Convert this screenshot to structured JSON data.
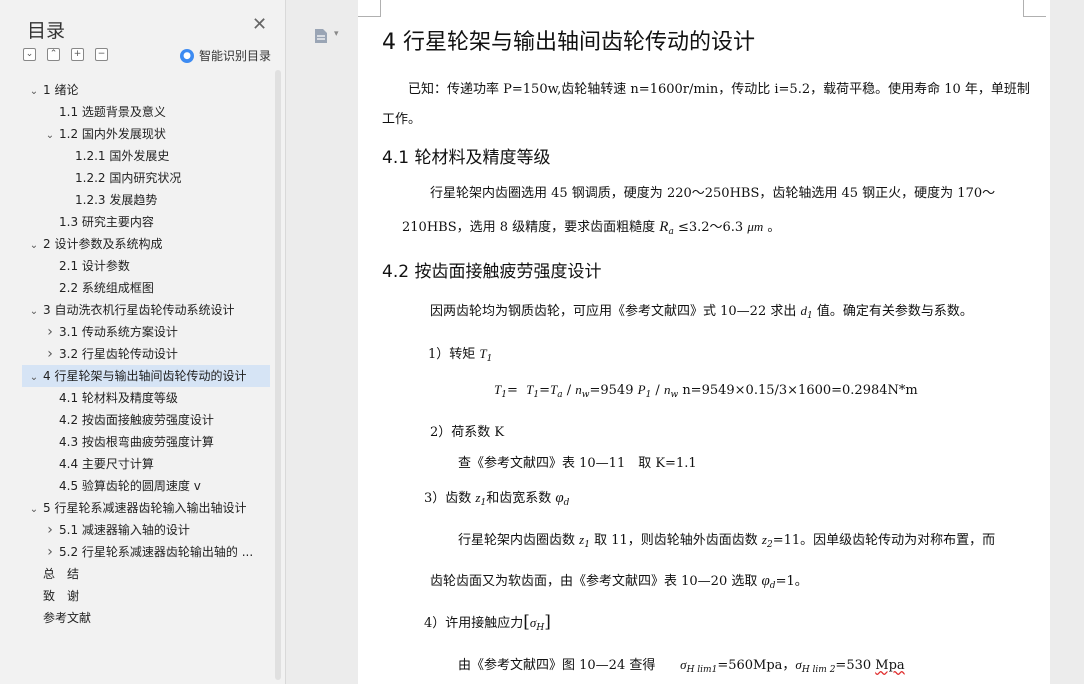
{
  "toc": {
    "title": "目录",
    "ai_label": "智能识别目录",
    "items": [
      {
        "label": "1 绪论",
        "chev": "v"
      },
      {
        "label": "1.1 选题背景及意义",
        "chev": ""
      },
      {
        "label": "1.2 国内外发展现状",
        "chev": "v"
      },
      {
        "label": "1.2.1 国外发展史",
        "chev": ""
      },
      {
        "label": "1.2.2 国内研究状况",
        "chev": ""
      },
      {
        "label": "1.2.3 发展趋势",
        "chev": ""
      },
      {
        "label": "1.3 研究主要内容",
        "chev": ""
      },
      {
        "label": "2 设计参数及系统构成",
        "chev": "v"
      },
      {
        "label": "2.1 设计参数",
        "chev": ""
      },
      {
        "label": "2.2 系统组成框图",
        "chev": ""
      },
      {
        "label": "3 自动洗衣机行星齿轮传动系统设计",
        "chev": "v"
      },
      {
        "label": "3.1 传动系统方案设计",
        "chev": ">"
      },
      {
        "label": "3.2 行星齿轮传动设计",
        "chev": ">"
      },
      {
        "label": "4 行星轮架与输出轴间齿轮传动的设计",
        "chev": "v"
      },
      {
        "label": "4.1 轮材料及精度等级",
        "chev": ""
      },
      {
        "label": "4.2 按齿面接触疲劳强度设计",
        "chev": ""
      },
      {
        "label": "4.3 按齿根弯曲疲劳强度计算",
        "chev": ""
      },
      {
        "label": "4.4 主要尺寸计算",
        "chev": ""
      },
      {
        "label": "4.5 验算齿轮的圆周速度 v",
        "chev": ""
      },
      {
        "label": "5 行星轮系减速器齿轮输入输出轴设计",
        "chev": "v"
      },
      {
        "label": "5.1 减速器输入轴的设计",
        "chev": ">"
      },
      {
        "label": "5.2 行星轮系减速器齿轮输出轴的 ...",
        "chev": ">"
      },
      {
        "label": "总　结",
        "chev": ""
      },
      {
        "label": "致　谢",
        "chev": ""
      },
      {
        "label": "参考文献",
        "chev": ""
      }
    ]
  },
  "doc": {
    "h1": "4 行星轮架与输出轴间齿轮传动的设计",
    "p_known_1": "已知：传递功率 P=150w,齿轮轴转速 n=1600r/min，传动比 i=5.2，载荷平稳。使用寿命 10 年，单班制",
    "p_known_2": "工作。",
    "h2_1": "4.1 轮材料及精度等级",
    "p41_1": "行星轮架内齿圈选用 45 钢调质，硬度为 220～250HBS，齿轮轴选用 45 钢正火，硬度为 170～",
    "p41_2a": "210HBS，选用 8 级精度，要求齿面粗糙度 ",
    "p41_2b": "R",
    "p41_2c": "a",
    "p41_2d": " ≤3.2～6.3 ",
    "p41_2e": "μm",
    "p41_2f": " 。",
    "h2_2": "4.2 按齿面接触疲劳强度设计",
    "p42_1a": "因两齿轮均为钢质齿轮，可应用《参考文献四》式 10—22 求出 ",
    "p42_1b": "d",
    "p42_1c": "1",
    "p42_1d": " 值。确定有关参数与系数。",
    "s1a": "1）转矩 ",
    "s1b": "T",
    "s1c": "1",
    "eq1": "=9549 ",
    "eq2": "n=9549×0.15/3×1600=0.2984N*m",
    "s2": "2）荷系数 K",
    "s2b": "查《参考文献四》表 10—11　取 K=1.1",
    "s3a": "3）齿数 ",
    "s3b": "和齿宽系数 ",
    "p3_1a": "行星轮架内齿圈齿数 ",
    "p3_1b": " 取 11，则齿轮轴外齿面齿数 ",
    "p3_1c": "=11。因单级齿轮传动为对称布置，而",
    "p3_2a": "齿轮齿面又为软齿面，由《参考文献四》表 10—20 选取 ",
    "p3_2b": "=1。",
    "s4a": "4）许用接触应力",
    "s4b": "由《参考文献四》图 10—24 查得",
    "s4c": "=560Mpa，",
    "s4d": "=530 ",
    "s4e": "Mpa"
  }
}
